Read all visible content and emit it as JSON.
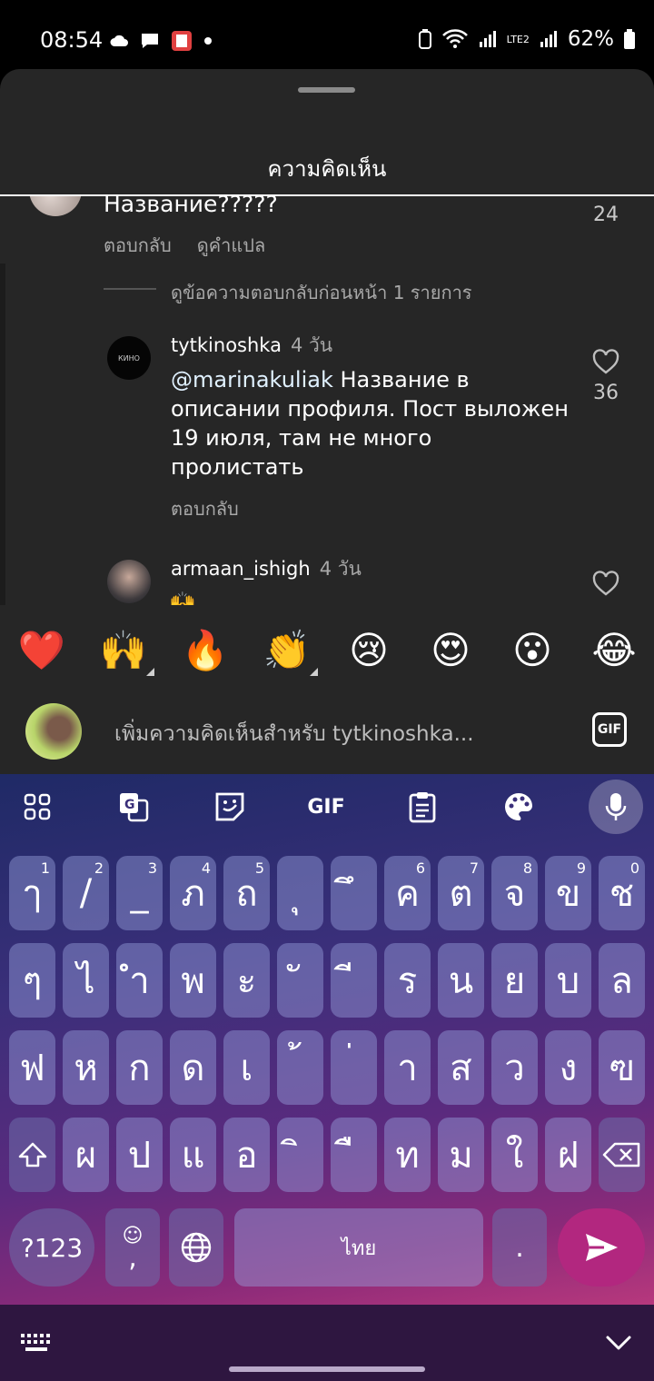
{
  "status_bar": {
    "time": "08:54",
    "battery": "62%",
    "network_label": "LTE2"
  },
  "sheet": {
    "title": "ความคิดเห็น"
  },
  "top_comment": {
    "text": "Название?????",
    "likes": "24",
    "reply_label": "ตอบกลับ",
    "translate_label": "ดูคำแปล"
  },
  "view_previous": "ดูข้อความตอบกลับก่อนหน้า 1 รายการ",
  "replies": [
    {
      "avatar_text": "КИНО",
      "username": "tytkinoshka",
      "time": "4 วัน",
      "mention": "@marinakuliak",
      "text": " Название в описании профиля. Пост выложен 19 июля, там не много пролистать",
      "likes": "36",
      "reply_label": "ตอบกลับ"
    },
    {
      "username": "armaan_ishigh",
      "time": "4 วัน",
      "text": "🙌"
    }
  ],
  "emoji_bar": [
    "❤️",
    "🙌",
    "🔥",
    "👏",
    "😢",
    "😍",
    "😮",
    "😂"
  ],
  "input": {
    "placeholder": "เพิ่มความคิดเห็นสำหรับ tytkinoshka...",
    "gif_label": "GIF"
  },
  "keyboard": {
    "toolbar_gif": "GIF",
    "row1": [
      {
        "k": "ๅ",
        "n": "1"
      },
      {
        "k": "/",
        "n": "2"
      },
      {
        "k": "_",
        "n": "3"
      },
      {
        "k": "ภ",
        "n": "4"
      },
      {
        "k": "ถ",
        "n": "5"
      },
      {
        "k": "ุ",
        "n": ""
      },
      {
        "k": "ึ",
        "n": ""
      },
      {
        "k": "ค",
        "n": "6"
      },
      {
        "k": "ต",
        "n": "7"
      },
      {
        "k": "จ",
        "n": "8"
      },
      {
        "k": "ข",
        "n": "9"
      },
      {
        "k": "ช",
        "n": "0"
      }
    ],
    "row2": [
      "ๆ",
      "ไ",
      "ำ",
      "พ",
      "ะ",
      "ั",
      "ี",
      "ร",
      "น",
      "ย",
      "บ",
      "ล"
    ],
    "row3": [
      "ฟ",
      "ห",
      "ก",
      "ด",
      "เ",
      "้",
      "่",
      "า",
      "ส",
      "ว",
      "ง",
      "ฃ"
    ],
    "row4": [
      "ผ",
      "ป",
      "แ",
      "อ",
      "ิ",
      "ื",
      "ท",
      "ม",
      "ใ",
      "ฝ"
    ],
    "symbols_label": "?123",
    "emoji_comma_top": "☺",
    "emoji_comma_bottom": ",",
    "space_label": "ไทย",
    "period_label": "."
  }
}
